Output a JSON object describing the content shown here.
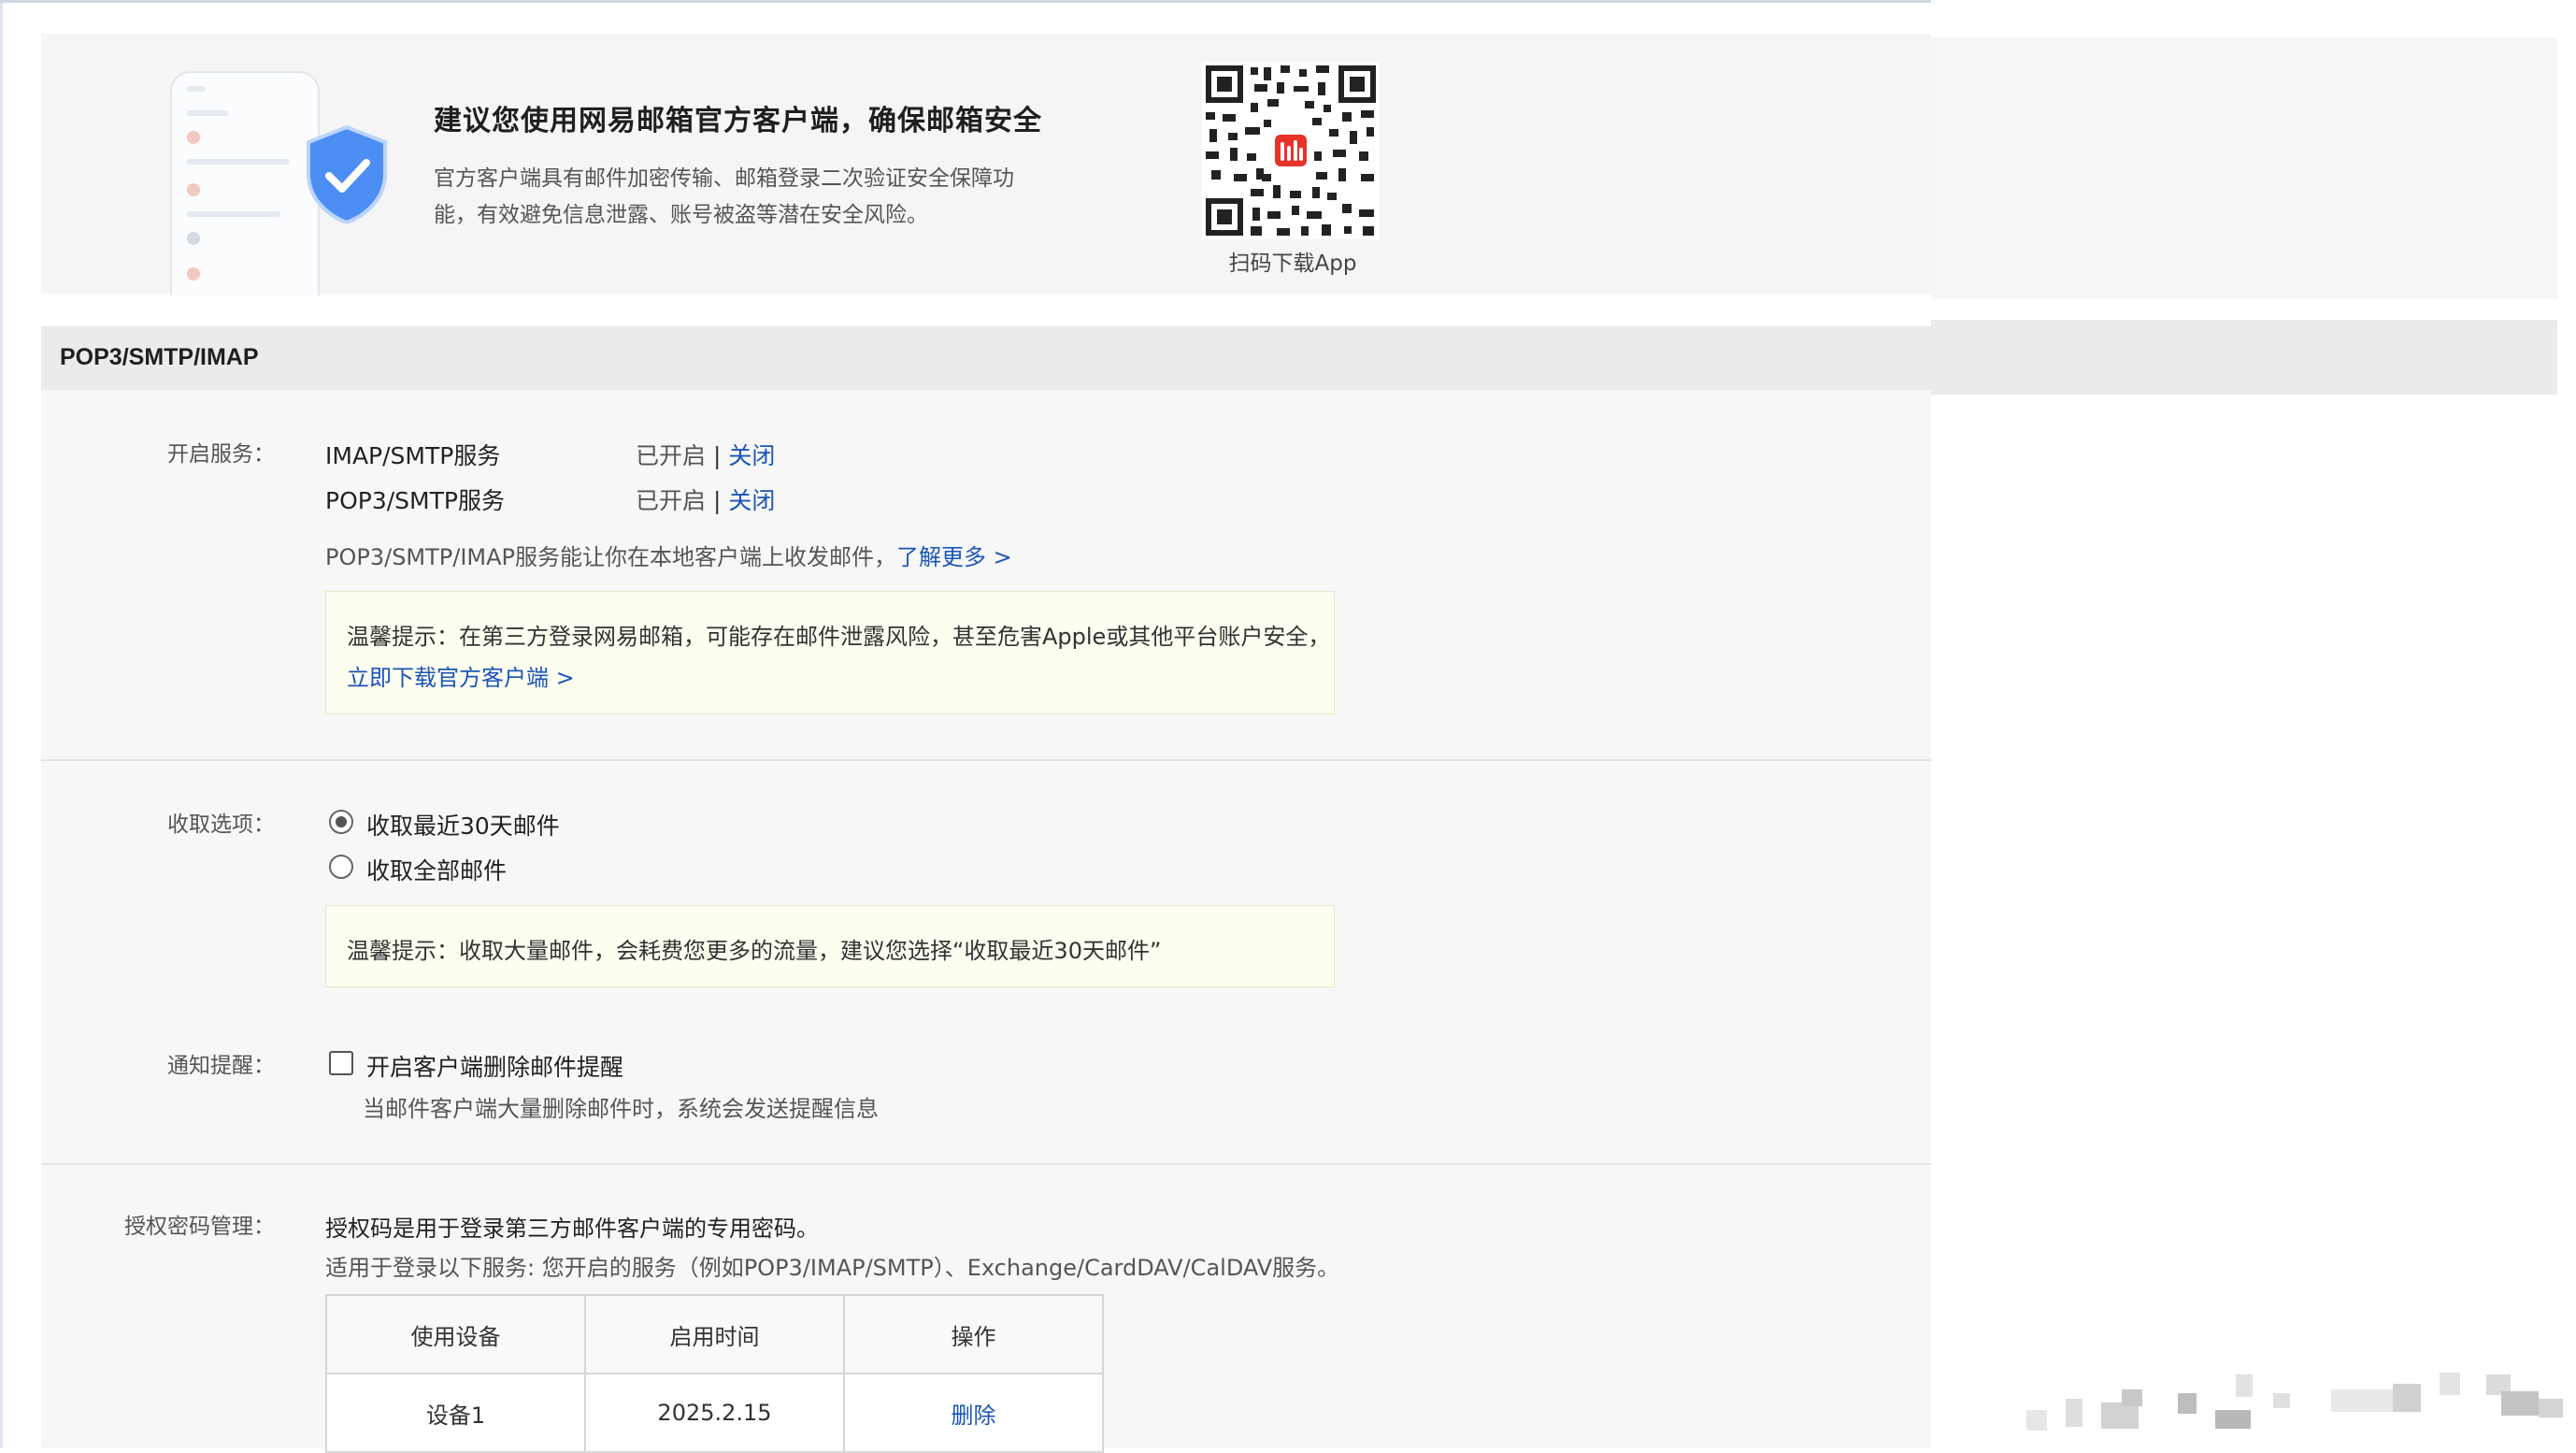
{
  "banner": {
    "title": "建议您使用网易邮箱官方客户端，确保邮箱安全",
    "description": "官方客户端具有邮件加密传输、邮箱登录二次验证安全保障功能，有效避免信息泄露、账号被盗等潜在安全风险。",
    "qr_label": "扫码下载App"
  },
  "section": {
    "title": "POP3/SMTP/IMAP"
  },
  "services": {
    "label": "开启服务：",
    "items": [
      {
        "name": "IMAP/SMTP服务",
        "status": "已开启",
        "separator": "|",
        "action": "关闭"
      },
      {
        "name": "POP3/SMTP服务",
        "status": "已开启",
        "separator": "|",
        "action": "关闭"
      }
    ],
    "info": "POP3/SMTP/IMAP服务能让你在本地客户端上收发邮件，",
    "learn_more": "了解更多 >",
    "tip_text": "温馨提示：在第三方登录网易邮箱，可能存在邮件泄露风险，甚至危害Apple或其他平台账户安全，",
    "tip_link": "立即下载官方客户端 >"
  },
  "receive": {
    "label": "收取选项：",
    "options": [
      {
        "label": "收取最近30天邮件",
        "selected": true
      },
      {
        "label": "收取全部邮件",
        "selected": false
      }
    ],
    "tip_text": "温馨提示：收取大量邮件，会耗费您更多的流量，建议您选择“收取最近30天邮件”"
  },
  "notify": {
    "label": "通知提醒：",
    "checkbox_label": "开启客户端删除邮件提醒",
    "checked": false,
    "description": "当邮件客户端大量删除邮件时，系统会发送提醒信息"
  },
  "auth": {
    "label": "授权密码管理：",
    "line1": "授权码是用于登录第三方邮件客户端的专用密码。",
    "line2": "适用于登录以下服务: 您开启的服务（例如POP3/IMAP/SMTP）、Exchange/CardDAV/CalDAV服务。",
    "table": {
      "headers": [
        "使用设备",
        "启用时间",
        "操作"
      ],
      "rows": [
        {
          "device": "设备1",
          "time": "2025.2.15",
          "action": "删除"
        }
      ]
    }
  },
  "colors": {
    "link": "#1a55b8",
    "banner_bg": "#f5f5f5",
    "section_bar": "#ebebeb",
    "tip_bg": "#fdfdf0",
    "qr_accent": "#e8332b",
    "shield": "#4d8ef5"
  },
  "icons": [
    "phone-mockup-icon",
    "shield-check-icon",
    "qr-code-icon",
    "netease-mail-logo-icon"
  ]
}
